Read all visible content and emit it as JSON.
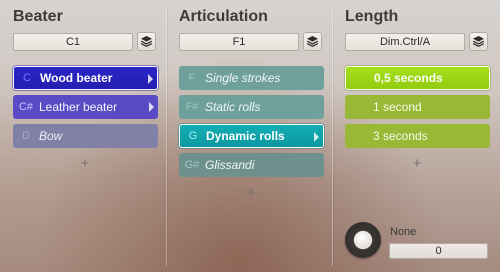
{
  "columns": {
    "beater": {
      "title": "Beater",
      "selector_value": "C1",
      "items": [
        {
          "key": "C",
          "label": "Wood beater"
        },
        {
          "key": "C#",
          "label": "Leather beater"
        },
        {
          "key": "D",
          "label": "Bow"
        }
      ],
      "selected_index": 0
    },
    "articulation": {
      "title": "Articulation",
      "selector_value": "F1",
      "items": [
        {
          "key": "F",
          "label": "Single strokes"
        },
        {
          "key": "F#",
          "label": "Static rolls"
        },
        {
          "key": "G",
          "label": "Dynamic rolls"
        },
        {
          "key": "G#",
          "label": "Glissandi"
        }
      ],
      "selected_index": 2
    },
    "length": {
      "title": "Length",
      "selector_value": "Dim.Ctrl/A",
      "items": [
        {
          "label": "0,5 seconds"
        },
        {
          "label": "1 second"
        },
        {
          "label": "3 seconds"
        }
      ],
      "selected_index": 0
    }
  },
  "add_label": "+",
  "knob": {
    "label": "None",
    "value": "0"
  },
  "colors": {
    "beater_accent": "#2c25c9",
    "articulation_accent": "#13aeb6",
    "length_accent": "#a6e01a"
  },
  "icons": {
    "stack": "layers-icon",
    "expand": "triangle-right-icon"
  }
}
